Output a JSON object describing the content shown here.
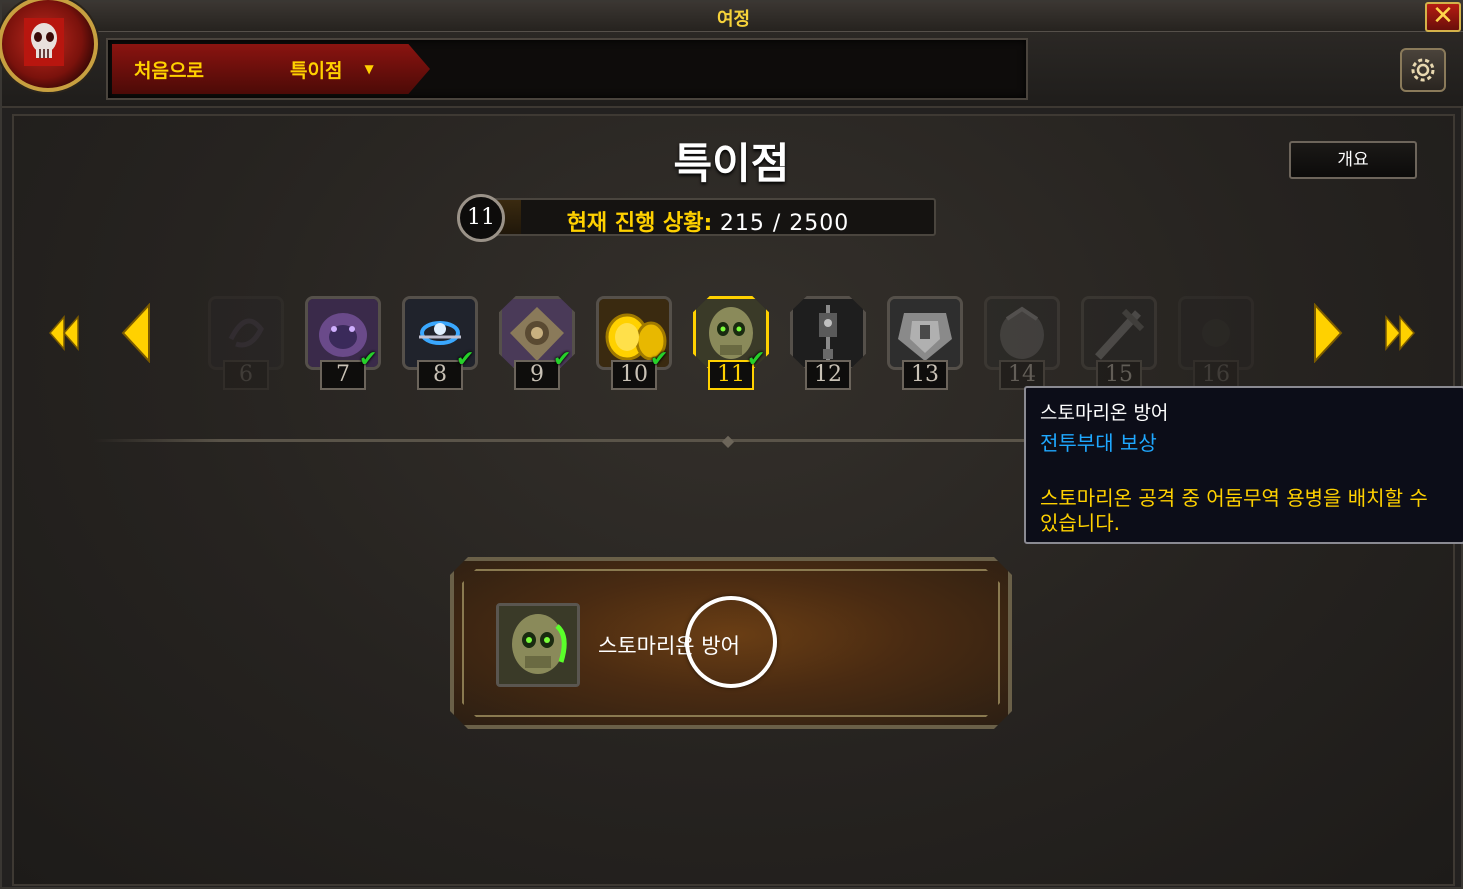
{
  "window": {
    "title": "여정",
    "close_label": "✕"
  },
  "breadcrumb": {
    "home": "처음으로",
    "current": "특이점",
    "dropdown_glyph": "▼"
  },
  "page": {
    "title": "특이점",
    "overview_label": "개요"
  },
  "progress": {
    "level": "11",
    "label": "현재 진행 상황:",
    "current": 215,
    "max": 2500,
    "value_text": "215 / 2500"
  },
  "track": {
    "items": [
      {
        "num": "6",
        "state": "faint",
        "completed": false,
        "icon": "rune-icon"
      },
      {
        "num": "7",
        "state": "normal",
        "completed": true,
        "icon": "purple-beast-icon"
      },
      {
        "num": "8",
        "state": "normal",
        "completed": true,
        "icon": "blue-portal-icon"
      },
      {
        "num": "9",
        "state": "normal",
        "completed": true,
        "icon": "gear-tabard-icon"
      },
      {
        "num": "10",
        "state": "normal",
        "completed": true,
        "icon": "gold-coins-icon"
      },
      {
        "num": "11",
        "state": "current",
        "completed": true,
        "icon": "green-skull-icon"
      },
      {
        "num": "12",
        "state": "normal",
        "completed": false,
        "icon": "banner-icon"
      },
      {
        "num": "13",
        "state": "normal",
        "completed": false,
        "icon": "armor-icon"
      },
      {
        "num": "14",
        "state": "dim",
        "completed": false,
        "icon": "helm-icon"
      },
      {
        "num": "15",
        "state": "dim",
        "completed": false,
        "icon": "weapon-icon"
      },
      {
        "num": "16",
        "state": "faint",
        "completed": false,
        "icon": "unknown-icon"
      }
    ]
  },
  "tooltip": {
    "title": "스토마리온 방어",
    "subtitle": "전투부대 보상",
    "description": "스토마리온 공격 중 어둠무역 용병을 배치할 수 있습니다."
  },
  "reward": {
    "name": "스토마리온 방어",
    "icon": "green-skull-icon"
  },
  "colors": {
    "accent_gold": "#ffd100",
    "tooltip_blue": "#1fa8ff",
    "check_green": "#26d02a",
    "crumb_red": "#8a1410"
  }
}
